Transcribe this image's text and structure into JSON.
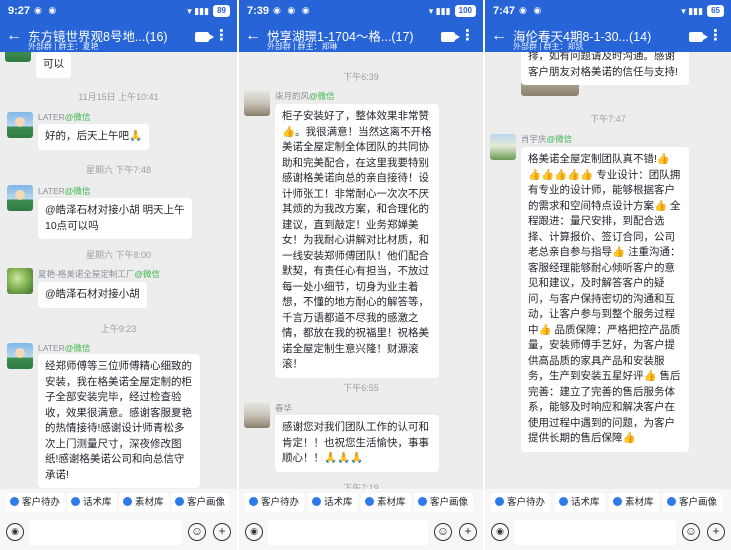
{
  "panels": [
    {
      "status": {
        "time": "9:27",
        "icons": "◉ ◉",
        "signal": "▾ ▮▮▮",
        "battery": "89"
      },
      "header": {
        "title": "东方镜世界观8号地...(16)",
        "sub_tag": "外部群",
        "sub_owner": "群主：夏艳"
      },
      "times": [
        "11月15日 上午10:41",
        "星期六 下午7:48",
        "星期六 下午8:00",
        "上午9:23"
      ],
      "messages": [
        {
          "text": "可以"
        },
        {
          "sender": "LATER",
          "channel": "@微信",
          "text": "好的，后天上午吧🙏"
        },
        {
          "sender": "LATER",
          "channel": "@微信",
          "text": "@皓泽石材对接小胡 明天上午10点可以吗"
        },
        {
          "sender": "夏艳-格美诺全屋定制工厂",
          "channel": "@微信",
          "text": "@皓泽石材对接小胡"
        },
        {
          "sender": "LATER",
          "channel": "@微信",
          "text": "经郑师傅等三位师傅精心细致的安装，我在格美诺全屋定制的柜子全部安装完毕，经过检查验收，效果很满意。感谢客服夏艳的热情接待!感谢设计师青松多次上门测量尺寸，深夜修改图纸!感谢格美诺公司和向总信守承诺!"
        }
      ]
    },
    {
      "status": {
        "time": "7:39",
        "icons": "◉ ◉ ◉",
        "signal": "▾ ▮▮▮",
        "battery": "100"
      },
      "header": {
        "title": "悦享湖璟1-1704～格...(17)",
        "sub_tag": "外部群",
        "sub_owner": "群主：郑琳"
      },
      "times": [
        "下午6:39",
        "下午6:55",
        "下午7:19"
      ],
      "messages": [
        {
          "sender": "柒月的风",
          "channel": "@微信",
          "text": "柜子安装好了，整体效果非常赞👍。我很满意！当然这离不开格美诺全屋定制全体团队的共同协助和完美配合，在这里我要特别感谢格美诺向总的亲自接待！设计师张工！非常耐心一次次不厌其烦的为我改方案，和合理化的建议，直到敲定！业务郑婵美女！为我耐心讲解对比材质，和一线安装郑师傅团队！他们配合默契，有责任心有担当，不放过每一处小细节，切身为业主着想，不懂的地方耐心的解答等，千言万语都道不尽我的感激之情，都放在我的祝福里！祝格美诺全屋定制生意兴隆！财源滚滚！"
        },
        {
          "sender": "春华",
          "channel": "",
          "text": "感谢您对我们团队工作的认可和肯定！！也祝您生活愉快，事事顺心！！🙏🙏🙏"
        }
      ]
    },
    {
      "status": {
        "time": "7:47",
        "icons": "◉ ◉",
        "signal": "▾ ▮▮▮",
        "battery": "65"
      },
      "header": {
        "title": "海伦春天4期8-1-30...(14)",
        "sub_tag": "外部群",
        "sub_owner": "群主：郑凯"
      },
      "times": [
        "下午7:47"
      ],
      "messages": [
        {
          "text": "排，如有问题请及时沟通。感谢客户朋友对格美诺的信任与支持!"
        },
        {
          "sender": "肖宇庆",
          "channel": "@微信",
          "text": "格美诺全屋定制团队真不错!👍👍👍👍👍👍 专业设计：团队拥有专业的设计师，能够根据客户的需求和空间特点设计方案👍 全程跟进：量尺安排，到配合选择、计算报价、签订合同，公司老总亲自参与指导👍 注重沟通：客服经理能够耐心倾听客户的意见和建议，及时解答客户的疑问，与客户保持密切的沟通和互动，让客户参与到整个服务过程中👍 品质保障：严格把控产品质量，安装师傅手艺好，为客户提供高品质的家具产品和安装服务，生产到安装五星好评👍 售后完善：建立了完善的售后服务体系，能够及时响应和解决客户在使用过程中遇到的问题，为客户提供长期的售后保障👍"
        }
      ]
    }
  ],
  "quickbar": {
    "b1": "客户待办",
    "b2": "话术库",
    "b3": "素材库",
    "b4": "客户画像"
  },
  "inputbar": {
    "voice": "◉",
    "emoji": "☺",
    "plus": "+"
  },
  "colors": {
    "header": "#2764d7",
    "background": "#ededed",
    "bubble": "#ffffff",
    "wechat": "#3bb44a"
  }
}
